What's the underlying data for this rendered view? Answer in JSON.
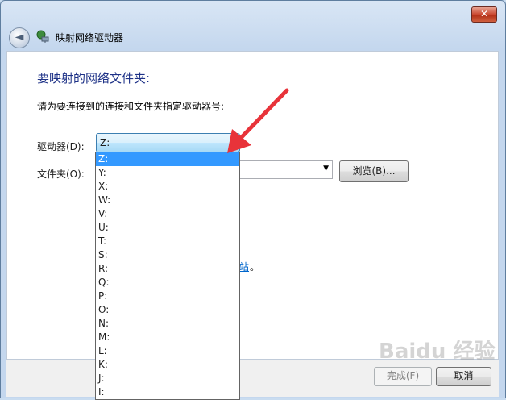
{
  "window": {
    "title": "映射网络驱动器",
    "close_label": "✕"
  },
  "back_label": "◄",
  "page": {
    "heading": "要映射的网络文件夹:",
    "instruction": "请为要连接到的连接和文件夹指定驱动器号:",
    "drive_label": "驱动器(D):",
    "drive_value": "Z:",
    "folder_label": "文件夹(O):",
    "browse_label": "浏览(B)...",
    "link_fragment": "站",
    "link_dot": "。"
  },
  "drive_options": [
    "Z:",
    "Y:",
    "X:",
    "W:",
    "V:",
    "U:",
    "T:",
    "S:",
    "R:",
    "Q:",
    "P:",
    "O:",
    "N:",
    "M:",
    "L:",
    "K:",
    "J:",
    "I:"
  ],
  "selected_option": "Z:",
  "footer": {
    "finish_label": "完成(F)",
    "cancel_label": "取消"
  },
  "watermark": "Baidu 经验",
  "colors": {
    "selection": "#3399ff",
    "arrow": "#e8333a",
    "heading": "#1e3287"
  }
}
